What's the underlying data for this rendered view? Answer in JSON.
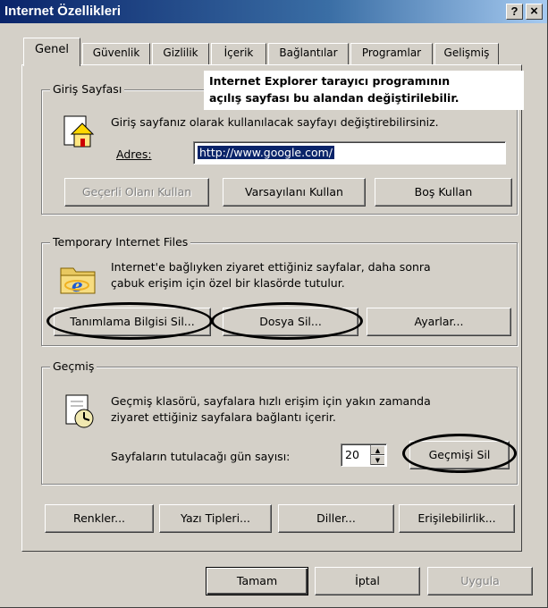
{
  "window": {
    "title": "Internet Özellikleri",
    "help_button": "?",
    "close_button": "×"
  },
  "tabs": [
    {
      "label": "Genel",
      "active": true
    },
    {
      "label": "Güvenlik",
      "active": false
    },
    {
      "label": "Gizlilik",
      "active": false
    },
    {
      "label": "İçerik",
      "active": false
    },
    {
      "label": "Bağlantılar",
      "active": false
    },
    {
      "label": "Programlar",
      "active": false
    },
    {
      "label": "Gelişmiş",
      "active": false
    }
  ],
  "callout": {
    "line1": "Internet Explorer tarayıcı programının",
    "line2": "açılış sayfası bu alandan değiştirilebilir."
  },
  "home_page": {
    "group_label": "Giriş Sayfası",
    "description": "Giriş sayfanız olarak kullanılacak sayfayı değiştirebilirsiniz.",
    "address_label": "Adres:",
    "address_value": "http://www.google.com/",
    "use_current_label": "Geçerli Olanı Kullan",
    "use_default_label": "Varsayılanı Kullan",
    "use_blank_label": "Boş Kullan"
  },
  "temp_files": {
    "group_label": "Temporary Internet Files",
    "description_line1": "Internet'e bağlıyken ziyaret ettiğiniz sayfalar, daha sonra",
    "description_line2": "çabuk erişim için özel bir klasörde tutulur.",
    "delete_cookies_label": "Tanımlama Bilgisi Sil...",
    "delete_files_label": "Dosya Sil...",
    "settings_label": "Ayarlar..."
  },
  "history": {
    "group_label": "Geçmiş",
    "description_line1": "Geçmiş klasörü, sayfalara hızlı erişim için yakın zamanda",
    "description_line2": "ziyaret ettiğiniz sayfalara bağlantı içerir.",
    "days_label": "Sayfaların tutulacağı gün sayısı:",
    "days_value": "20",
    "clear_history_label": "Geçmişi Sil"
  },
  "bottom_buttons": {
    "colors_label": "Renkler...",
    "fonts_label": "Yazı Tipleri...",
    "languages_label": "Diller...",
    "accessibility_label": "Erişilebilirlik..."
  },
  "dialog_buttons": {
    "ok_label": "Tamam",
    "cancel_label": "İptal",
    "apply_label": "Uygula"
  },
  "colors": {
    "titlebar_start": "#0a246a",
    "face": "#d4d0c8",
    "selection": "#0a246a"
  }
}
